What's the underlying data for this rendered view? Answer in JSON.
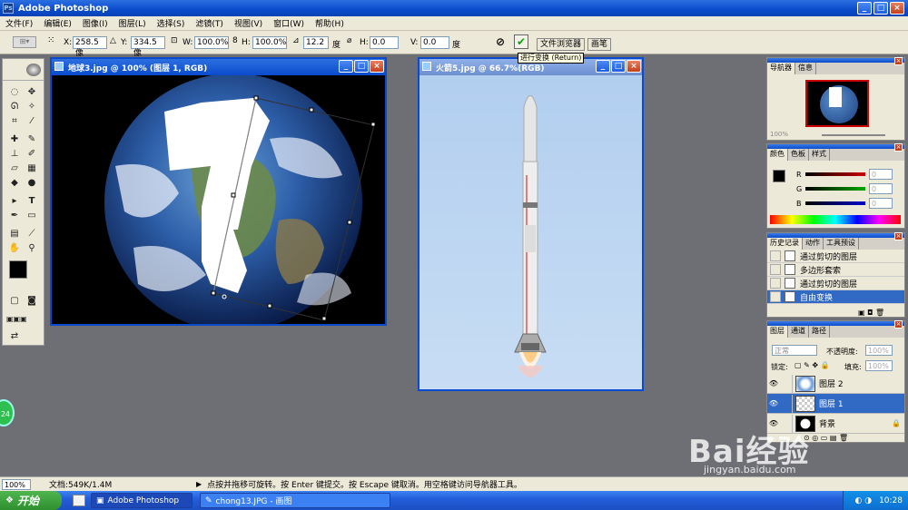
{
  "app": {
    "title": "Adobe Photoshop"
  },
  "menu": [
    "文件(F)",
    "编辑(E)",
    "图像(I)",
    "图层(L)",
    "选择(S)",
    "滤镜(T)",
    "视图(V)",
    "窗口(W)",
    "帮助(H)"
  ],
  "options": {
    "x_label": "X:",
    "x_value": "258.5 像",
    "y_label": "Y:",
    "y_value": "334.5 像",
    "w_label": "W:",
    "w_value": "100.0%",
    "h_label": "H:",
    "h_value": "100.0%",
    "angle_value": "12.2",
    "angle_unit": "度",
    "hskew_label": "H:",
    "hskew_value": "0.0",
    "vskew_label": "V:",
    "vskew_value": "0.0",
    "skew_unit": "度",
    "tab_file_browser": "文件浏览器",
    "tab_brushes": "画笔",
    "tooltip": "进行变换 (Return)"
  },
  "doc_earth": {
    "title": "地球3.jpg @ 100% (图层 1, RGB)"
  },
  "doc_rocket": {
    "title": "火箭5.jpg @ 66.7%(RGB)"
  },
  "navigator": {
    "tabs": [
      "导航器",
      "信息"
    ],
    "zoom": "100%"
  },
  "color_panel": {
    "tabs": [
      "颜色",
      "色板",
      "样式"
    ],
    "r_label": "R",
    "g_label": "G",
    "b_label": "B",
    "r": "0",
    "g": "0",
    "b": "0"
  },
  "history": {
    "tabs": [
      "历史记录",
      "动作",
      "工具预设"
    ],
    "items": [
      "通过剪切的图层",
      "多边形套索",
      "通过剪切的图层",
      "自由变换"
    ]
  },
  "layers": {
    "tabs": [
      "图层",
      "通道",
      "路径"
    ],
    "blend_mode": "正常",
    "opacity_label": "不透明度:",
    "opacity": "100%",
    "lock_label": "锁定:",
    "fill_label": "填充:",
    "fill": "100%",
    "items": [
      "图层 2",
      "图层 1",
      "背景"
    ]
  },
  "status": {
    "zoom": "100%",
    "doc_size": "文档:549K/1.4M",
    "hint": "点按并拖移可旋转。按 Enter 键提交。按 Escape 键取消。用空格键访问导航器工具。"
  },
  "taskbar": {
    "start": "开始",
    "task1": "Adobe Photoshop",
    "task2": "chong13.JPG - 画图",
    "time": "10:28"
  },
  "floating_badge": "24",
  "watermark": {
    "logo": "Bai经验",
    "url": "jingyan.baidu.com"
  },
  "colors": {
    "xp_blue": "#0a4bcc",
    "panel_bg": "#ece9d8",
    "desktop": "#6e6e75",
    "sky": "#b8d4f2"
  }
}
